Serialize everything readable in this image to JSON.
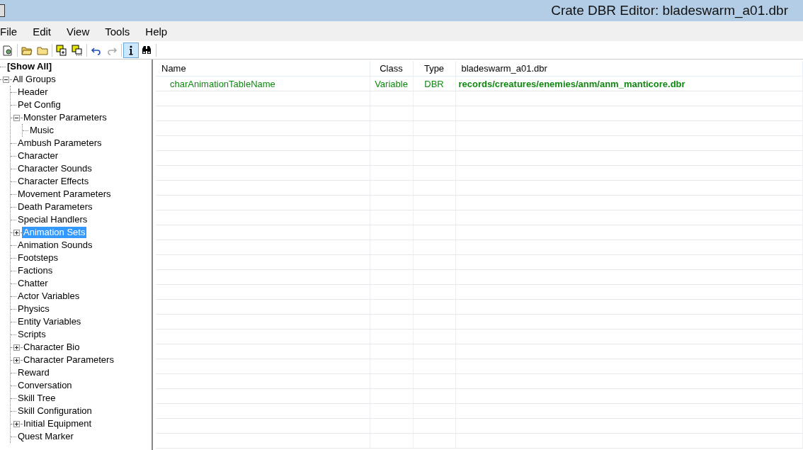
{
  "window": {
    "title": "Crate DBR Editor: bladeswarm_a01.dbr"
  },
  "menu": [
    "File",
    "Edit",
    "View",
    "Tools",
    "Help"
  ],
  "toolbar": [
    {
      "kind": "document",
      "pressed": false
    },
    {
      "kind": "sep"
    },
    {
      "kind": "folder-open",
      "pressed": false
    },
    {
      "kind": "folder",
      "pressed": false
    },
    {
      "kind": "sep"
    },
    {
      "kind": "save-copy",
      "pressed": false
    },
    {
      "kind": "save-more",
      "pressed": false
    },
    {
      "kind": "sep"
    },
    {
      "kind": "undo",
      "pressed": false
    },
    {
      "kind": "redo",
      "pressed": false,
      "disabled": true
    },
    {
      "kind": "sep"
    },
    {
      "kind": "info",
      "pressed": true
    },
    {
      "kind": "binoculars",
      "pressed": false
    },
    {
      "kind": "sep"
    }
  ],
  "tree": [
    {
      "label": "[Show All]",
      "selected": false,
      "bold": true
    },
    {
      "label": "All Groups",
      "selected": false,
      "expanded": true,
      "children": [
        {
          "label": "Header",
          "selected": false
        },
        {
          "label": "Pet Config",
          "selected": false
        },
        {
          "label": "Monster Parameters",
          "selected": false,
          "expanded": true,
          "children": [
            {
              "label": "Music",
              "selected": false
            }
          ]
        },
        {
          "label": "Ambush Parameters",
          "selected": false
        },
        {
          "label": "Character",
          "selected": false
        },
        {
          "label": "Character Sounds",
          "selected": false
        },
        {
          "label": "Character Effects",
          "selected": false
        },
        {
          "label": "Movement Parameters",
          "selected": false
        },
        {
          "label": "Death Parameters",
          "selected": false
        },
        {
          "label": "Special Handlers",
          "selected": false
        },
        {
          "label": "Animation Sets",
          "selected": true,
          "expanded": false
        },
        {
          "label": "Animation Sounds",
          "selected": false
        },
        {
          "label": "Footsteps",
          "selected": false
        },
        {
          "label": "Factions",
          "selected": false
        },
        {
          "label": "Chatter",
          "selected": false
        },
        {
          "label": "Actor Variables",
          "selected": false
        },
        {
          "label": "Physics",
          "selected": false
        },
        {
          "label": "Entity Variables",
          "selected": false
        },
        {
          "label": "Scripts",
          "selected": false
        },
        {
          "label": "Character Bio",
          "selected": false,
          "expanded": false
        },
        {
          "label": "Character Parameters",
          "selected": false,
          "expanded": false
        },
        {
          "label": "Reward",
          "selected": false
        },
        {
          "label": "Conversation",
          "selected": false
        },
        {
          "label": "Skill Tree",
          "selected": false
        },
        {
          "label": "Skill Configuration",
          "selected": false
        },
        {
          "label": "Initial Equipment",
          "selected": false,
          "expanded": false
        },
        {
          "label": "Quest Marker",
          "selected": false
        }
      ]
    }
  ],
  "table": {
    "columns": [
      "Name",
      "Class",
      "Type",
      "bladeswarm_a01.dbr"
    ],
    "rows": [
      [
        "charAnimationTableName",
        "Variable",
        "DBR",
        "records/creatures/enemies/anm/anm_manticore.dbr"
      ]
    ]
  }
}
